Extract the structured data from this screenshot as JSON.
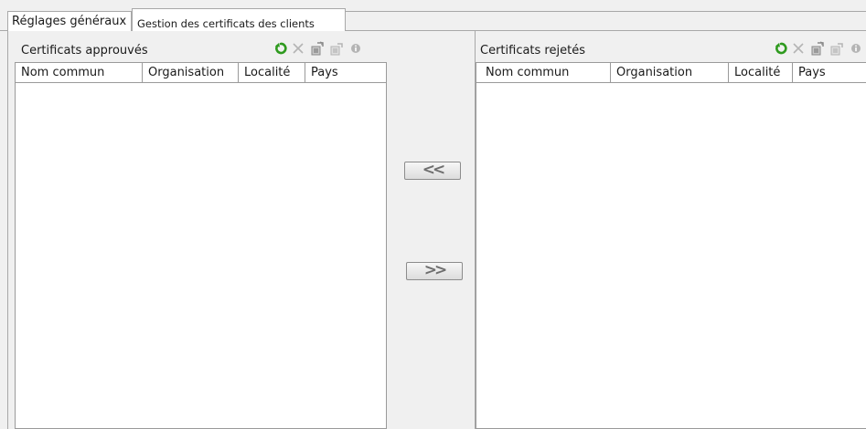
{
  "tabs": [
    {
      "label": "Réglages généraux"
    },
    {
      "label": "Gestion des certificats des clients"
    }
  ],
  "approved": {
    "title": "Certificats approuvés",
    "columns": [
      "Nom commun",
      "Organisation",
      "Localité",
      "Pays"
    ],
    "toolbar": [
      "refresh-icon",
      "delete-icon",
      "import-icon",
      "export-icon",
      "info-icon"
    ]
  },
  "rejected": {
    "title": "Certificats rejetés",
    "columns": [
      "Nom commun",
      "Organisation",
      "Localité",
      "Pays"
    ],
    "toolbar": [
      "refresh-icon",
      "delete-icon",
      "import-icon",
      "export-icon",
      "info-icon"
    ]
  },
  "buttons": {
    "move_to_approved": "<<",
    "move_to_rejected": ">>"
  },
  "colors": {
    "refresh_icon": "#2e9a1e",
    "disabled_icon": "#b4b4b4",
    "background": "#f0f0f0"
  }
}
